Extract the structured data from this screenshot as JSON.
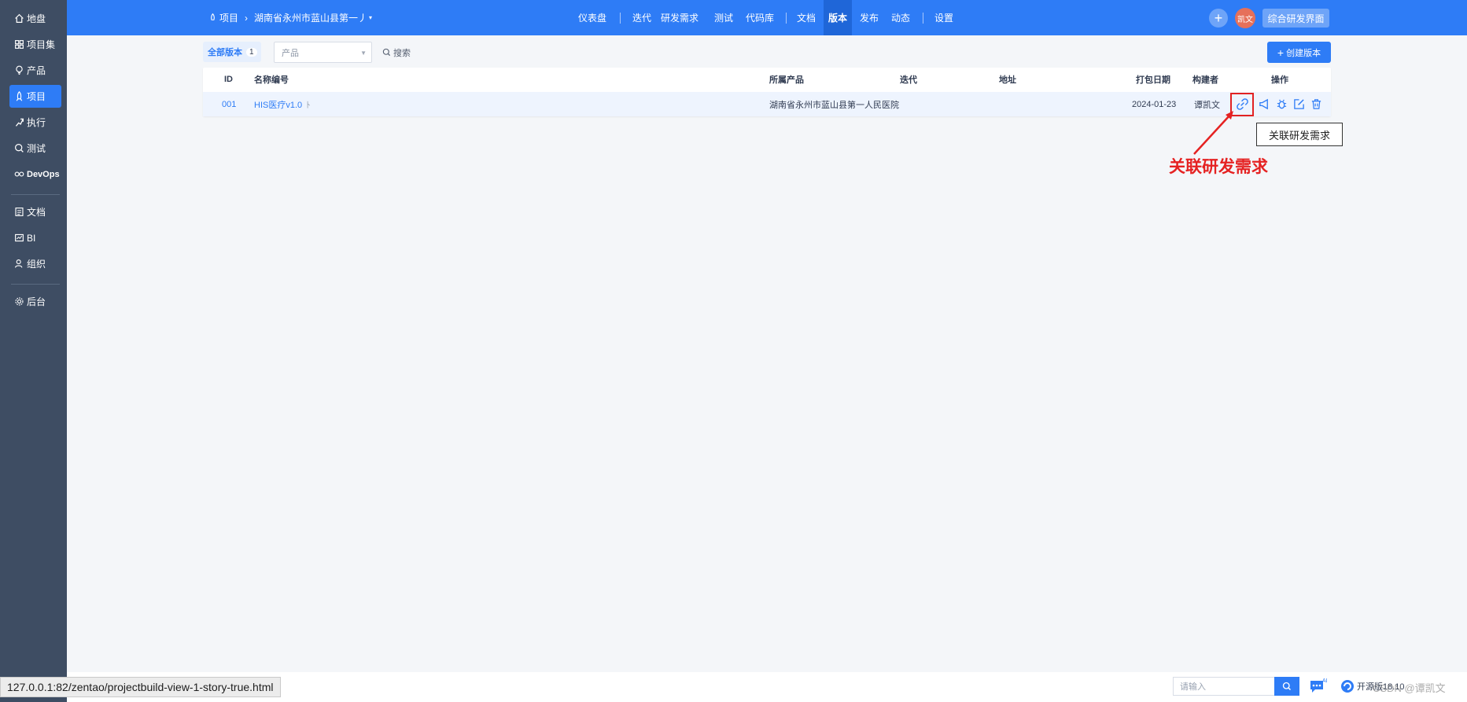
{
  "sidebar": {
    "items": [
      {
        "label": "地盘",
        "icon": "home-icon"
      },
      {
        "label": "项目集",
        "icon": "grid-icon"
      },
      {
        "label": "产品",
        "icon": "lightbulb-icon"
      },
      {
        "label": "项目",
        "icon": "rocket-icon",
        "active": true
      },
      {
        "label": "执行",
        "icon": "run-icon"
      },
      {
        "label": "测试",
        "icon": "magnify-icon"
      },
      {
        "label": "DevOps",
        "icon": "infinity-icon"
      },
      {
        "label": "文档",
        "icon": "document-icon"
      },
      {
        "label": "BI",
        "icon": "chart-icon"
      },
      {
        "label": "组织",
        "icon": "people-icon"
      },
      {
        "label": "后台",
        "icon": "gear-icon"
      }
    ]
  },
  "header": {
    "breadcrumb_root": "项目",
    "breadcrumb_project": "湖南省永州市蓝山县第一丿",
    "nav": [
      "仪表盘",
      "迭代",
      "研发需求",
      "测试",
      "代码库",
      "文档",
      "版本",
      "发布",
      "动态",
      "设置"
    ],
    "active_nav": "版本",
    "avatar_text": "凯文",
    "mode_button": "综合研发界面"
  },
  "toolbar": {
    "tab_all_label": "全部版本",
    "tab_all_count": "1",
    "product_placeholder": "产品",
    "search_label": "搜索",
    "create_label": "创建版本"
  },
  "table": {
    "headers": [
      "ID",
      "名称编号",
      "所属产品",
      "迭代",
      "地址",
      "打包日期",
      "构建者",
      "操作"
    ],
    "rows": [
      {
        "id": "001",
        "name": "HIS医疗v1.0",
        "product": "湖南省永州市蓝山县第一人民医院",
        "iteration": "",
        "address": "",
        "date": "2024-01-23",
        "builder": "谭凯文"
      }
    ]
  },
  "tooltip": "关联研发需求",
  "annotation": "关联研发需求",
  "status_url": "127.0.0.1:82/zentao/projectbuild-view-1-story-true.html",
  "bottom": {
    "search_placeholder": "请输入",
    "version": "开源版18.10",
    "watermark": "CSDN @谭凯文"
  },
  "colors": {
    "primary": "#2e7cf6",
    "sidebar": "#3e4d63",
    "annotation_red": "#e22222"
  }
}
